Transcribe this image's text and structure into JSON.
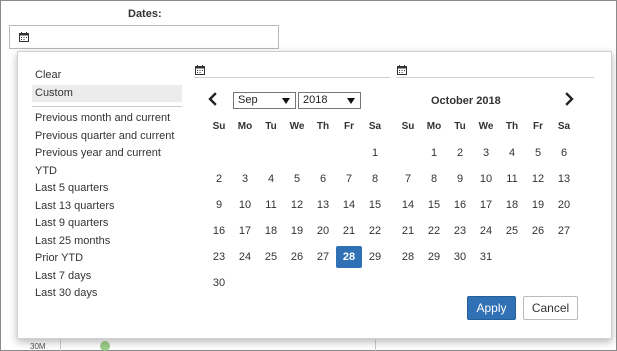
{
  "filter": {
    "label": "Dates:"
  },
  "background": {
    "partial_text": "30M"
  },
  "ranges": {
    "top": [
      "Clear",
      "Custom"
    ],
    "presets": [
      "Previous month and current",
      "Previous quarter and current",
      "Previous year and current",
      "YTD",
      "Last 5 quarters",
      "Last 13 quarters",
      "Last 9 quarters",
      "Last 25 months",
      "Prior YTD",
      "Last 7 days",
      "Last 30 days"
    ],
    "active": "Custom"
  },
  "left_calendar": {
    "month_select": "Sep",
    "year_select": "2018",
    "weekdays": [
      "Su",
      "Mo",
      "Tu",
      "We",
      "Th",
      "Fr",
      "Sa"
    ],
    "weeks": [
      [
        "",
        "",
        "",
        "",
        "",
        "",
        "1"
      ],
      [
        "2",
        "3",
        "4",
        "5",
        "6",
        "7",
        "8"
      ],
      [
        "9",
        "10",
        "11",
        "12",
        "13",
        "14",
        "15"
      ],
      [
        "16",
        "17",
        "18",
        "19",
        "20",
        "21",
        "22"
      ],
      [
        "23",
        "24",
        "25",
        "26",
        "27",
        "28",
        "29"
      ],
      [
        "30",
        "",
        "",
        "",
        "",
        "",
        ""
      ]
    ],
    "selected_day": "28"
  },
  "right_calendar": {
    "title": "October 2018",
    "weekdays": [
      "Su",
      "Mo",
      "Tu",
      "We",
      "Th",
      "Fr",
      "Sa"
    ],
    "weeks": [
      [
        "",
        "1",
        "2",
        "3",
        "4",
        "5",
        "6"
      ],
      [
        "7",
        "8",
        "9",
        "10",
        "11",
        "12",
        "13"
      ],
      [
        "14",
        "15",
        "16",
        "17",
        "18",
        "19",
        "20"
      ],
      [
        "21",
        "22",
        "23",
        "24",
        "25",
        "26",
        "27"
      ],
      [
        "28",
        "29",
        "30",
        "31",
        "",
        "",
        ""
      ]
    ]
  },
  "buttons": {
    "apply": "Apply",
    "cancel": "Cancel"
  },
  "icons": {
    "calendar": "calendar-icon",
    "prev": "chevron-left-icon",
    "next": "chevron-right-icon"
  },
  "colors": {
    "accent": "#3071b5"
  }
}
